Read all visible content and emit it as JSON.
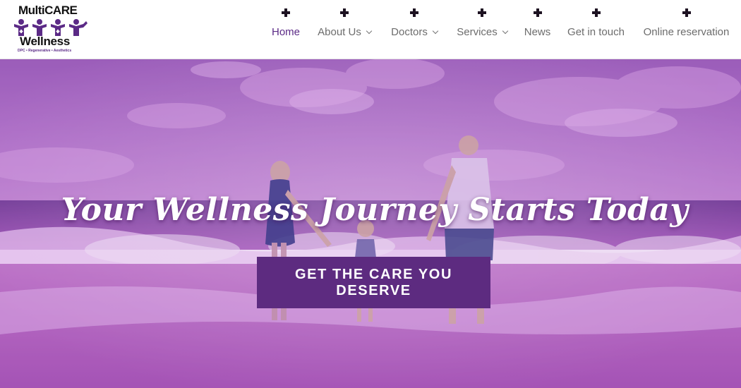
{
  "brand": {
    "name_top": "MultiCARE",
    "name_bottom": "Wellness",
    "tagline": "DPC • Regenerative • Aesthetics",
    "accent": "#5b2a86"
  },
  "nav": {
    "items": [
      {
        "label": "Home",
        "active": true,
        "dropdown": false
      },
      {
        "label": "About Us",
        "active": false,
        "dropdown": true
      },
      {
        "label": "Doctors",
        "active": false,
        "dropdown": true
      },
      {
        "label": "Services",
        "active": false,
        "dropdown": true
      },
      {
        "label": "News",
        "active": false,
        "dropdown": false
      },
      {
        "label": "Get in touch",
        "active": false,
        "dropdown": false
      },
      {
        "label": "Online reservation",
        "active": false,
        "dropdown": false
      }
    ],
    "icon": "plus-icon"
  },
  "hero": {
    "title": "Your Wellness Journey Starts Today",
    "cta_label": "GET THE CARE YOU DESERVE",
    "cta_color": "#5d2b80",
    "overlay_color": "#a040c0"
  }
}
